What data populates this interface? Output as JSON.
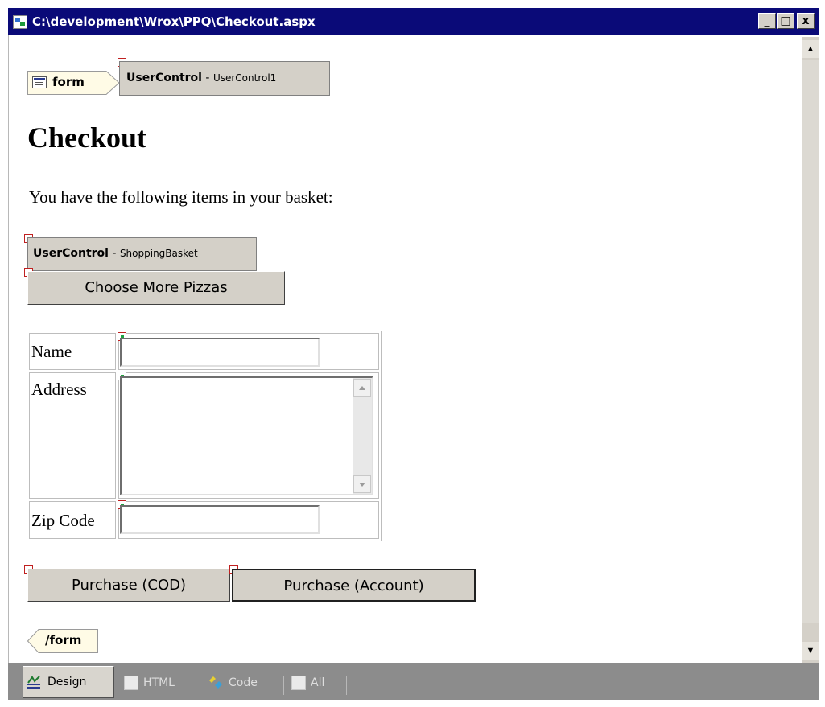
{
  "window": {
    "title": "C:\\development\\Wrox\\PPQ\\Checkout.aspx",
    "controls": {
      "minimize": "_",
      "maximize": "□",
      "close": "x"
    }
  },
  "design": {
    "form_tag": "form",
    "form_end_tag": "/form",
    "user_control_1": {
      "type": "UserControl",
      "separator": " - ",
      "name": "UserControl1"
    },
    "heading": "Checkout",
    "intro_text": "You have the following items in your basket:",
    "user_control_2": {
      "type": "UserControl",
      "separator": " - ",
      "name": "ShoppingBasket"
    },
    "choose_more_button": "Choose More Pizzas",
    "form_fields": [
      {
        "label": "Name",
        "value": ""
      },
      {
        "label": "Address",
        "value": ""
      },
      {
        "label": "Zip Code",
        "value": ""
      }
    ],
    "purchase_cod_button": "Purchase (COD)",
    "purchase_account_button": "Purchase (Account)"
  },
  "scrollbar": {
    "up_arrow": "▲",
    "down_arrow": "▼"
  },
  "view_tabs": [
    {
      "label": "Design",
      "active": true,
      "icon": "design-icon"
    },
    {
      "label": "HTML",
      "active": false,
      "icon": "html-icon"
    },
    {
      "label": "Code",
      "active": false,
      "icon": "code-icon"
    },
    {
      "label": "All",
      "active": false,
      "icon": "all-icon"
    }
  ],
  "colors": {
    "titlebar": "#0a0a78",
    "chrome": "#d4d0c8",
    "tabbar": "#8c8c8c"
  }
}
